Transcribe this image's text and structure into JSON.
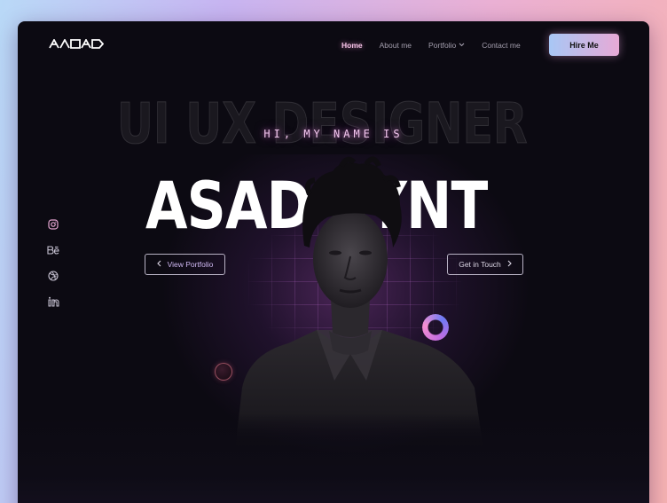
{
  "brand": {
    "logo_icon": "asad-logo-mark"
  },
  "nav": {
    "items": [
      {
        "label": "Home",
        "active": true
      },
      {
        "label": "About me",
        "active": false
      },
      {
        "label": "Portfolio",
        "active": false,
        "dropdown": true
      },
      {
        "label": "Contact me",
        "active": false
      }
    ],
    "cta_label": "Hire Me"
  },
  "hero": {
    "background_title": "UI UX DESIGNER",
    "greeting": "HI, MY NAME IS",
    "name": "ASAD SYNT",
    "left_button": "View Portfolio",
    "right_button": "Get in Touch"
  },
  "social": [
    {
      "icon": "instagram-icon"
    },
    {
      "icon": "behance-icon"
    },
    {
      "icon": "dribbble-icon"
    },
    {
      "icon": "linkedin-icon"
    }
  ],
  "colors": {
    "background": "#0c0a12",
    "accent_pink": "#f2c6ee",
    "accent_gradient_start": "#a8c7f5",
    "accent_gradient_end": "#e7a9d6"
  }
}
